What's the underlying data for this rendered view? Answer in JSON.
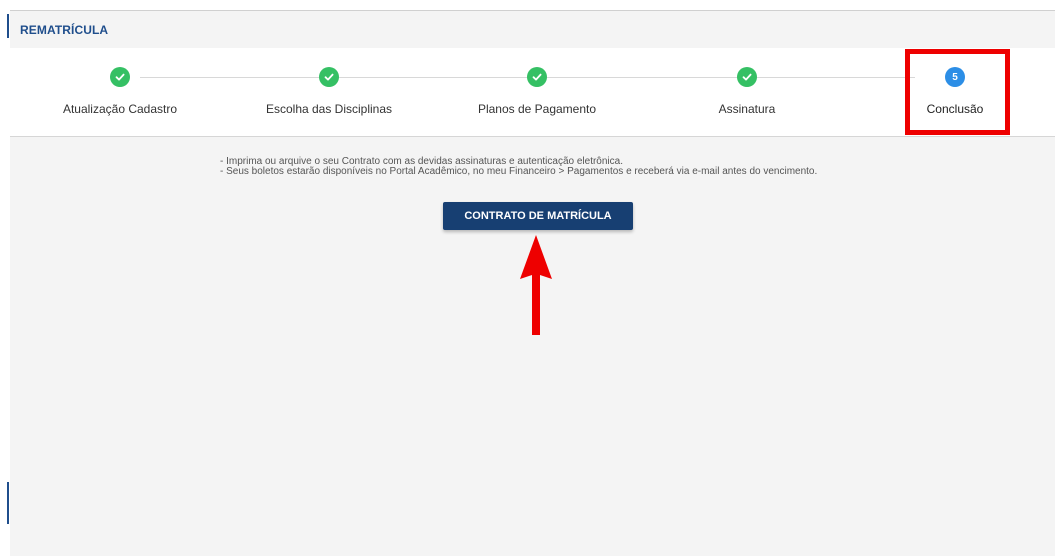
{
  "header": {
    "title": "REMATRÍCULA"
  },
  "stepper": {
    "steps": [
      {
        "label": "Atualização Cadastro",
        "status": "completed"
      },
      {
        "label": "Escolha das Disciplinas",
        "status": "completed"
      },
      {
        "label": "Planos de Pagamento",
        "status": "completed"
      },
      {
        "label": "Assinatura",
        "status": "completed"
      },
      {
        "label": "Conclusão",
        "status": "current",
        "number": "5"
      }
    ]
  },
  "content": {
    "line1": "- Imprima ou arquive o seu Contrato com as devidas assinaturas e autenticação eletrônica.",
    "line2": "- Seus boletos estarão disponíveis no Portal Acadêmico, no meu Financeiro > Pagamentos e receberá via e-mail antes do vencimento.",
    "button_label": "CONTRATO DE MATRÍCULA"
  },
  "colors": {
    "brand": "#1f4e8c",
    "button": "#173f72",
    "complete": "#35c064",
    "current": "#2c8ee6",
    "annotation": "#ee0000"
  },
  "icons": {
    "completed": "check-circle-icon",
    "annotation": "arrow-up-icon"
  }
}
